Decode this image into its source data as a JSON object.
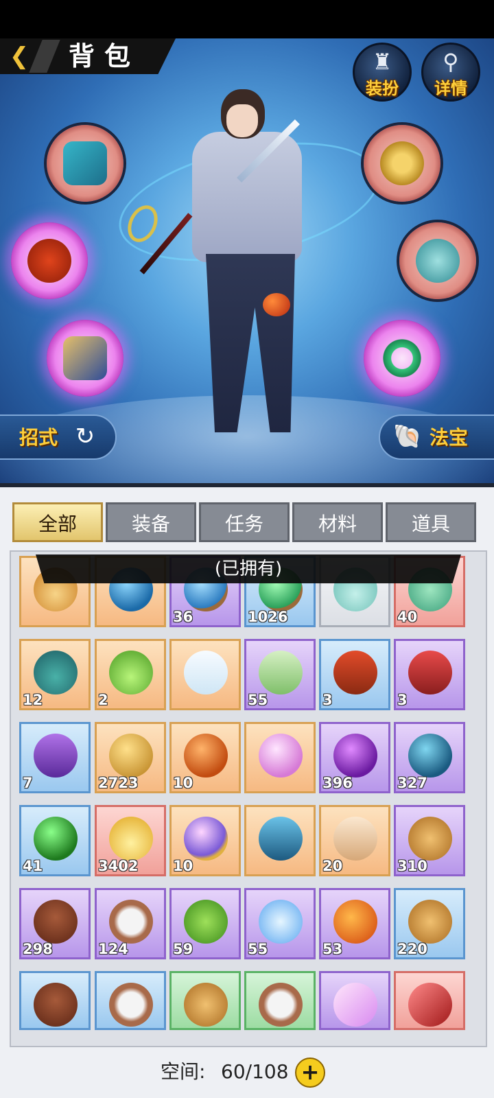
{
  "header": {
    "title": "背包",
    "back_icon": "back-arrow-icon"
  },
  "hero_buttons": {
    "outfit_label": "装扮",
    "detail_label": "详情"
  },
  "side_tabs": {
    "moves_label": "招式",
    "treasure_label": "法宝"
  },
  "tabs": [
    {
      "label": "全部",
      "active": true
    },
    {
      "label": "装备",
      "active": false
    },
    {
      "label": "任务",
      "active": false
    },
    {
      "label": "材料",
      "active": false
    },
    {
      "label": "道具",
      "active": false
    }
  ],
  "banner": "(已拥有)",
  "colors": {
    "accent_gold": "#f0c23a",
    "tab_active": "#e2c56d",
    "tab_inactive": "#868b94"
  },
  "items": [
    {
      "icon": "flame-crown-icon",
      "rarity": "orange",
      "count": ""
    },
    {
      "icon": "blue-orb-icon",
      "rarity": "orange",
      "count": ""
    },
    {
      "icon": "blue-orb-stand-icon",
      "rarity": "purple",
      "count": "36"
    },
    {
      "icon": "green-orb-stand-icon",
      "rarity": "blue",
      "count": "1026"
    },
    {
      "icon": "jade-vase-icon",
      "rarity": "gray",
      "count": ""
    },
    {
      "icon": "jade-hook-icon",
      "rarity": "red",
      "count": "40"
    },
    {
      "icon": "teal-pouch-icon",
      "rarity": "orange",
      "count": "12"
    },
    {
      "icon": "green-potion-icon",
      "rarity": "orange",
      "count": "2"
    },
    {
      "icon": "blank-scroll-icon",
      "rarity": "orange",
      "count": ""
    },
    {
      "icon": "green-talisman-icon",
      "rarity": "purple",
      "count": "55"
    },
    {
      "icon": "treasure-chest-icon",
      "rarity": "blue",
      "count": "3"
    },
    {
      "icon": "red-scroll-icon",
      "rarity": "purple",
      "count": "3"
    },
    {
      "icon": "purple-scroll-icon",
      "rarity": "blue",
      "count": "7"
    },
    {
      "icon": "golden-egg-icon",
      "rarity": "orange",
      "count": "2723"
    },
    {
      "icon": "orange-orb-icon",
      "rarity": "orange",
      "count": "10"
    },
    {
      "icon": "pink-pearl-icon",
      "rarity": "orange",
      "count": ""
    },
    {
      "icon": "purple-orb-icon",
      "rarity": "purple",
      "count": "396"
    },
    {
      "icon": "teal-orb-icon",
      "rarity": "purple",
      "count": "327"
    },
    {
      "icon": "green-orb-icon",
      "rarity": "blue",
      "count": "41"
    },
    {
      "icon": "golden-drop-icon",
      "rarity": "red",
      "count": "3402"
    },
    {
      "icon": "rainbow-orb-icon",
      "rarity": "orange",
      "count": "10"
    },
    {
      "icon": "meditation-card-icon",
      "rarity": "orange",
      "count": ""
    },
    {
      "icon": "rune-paper-icon",
      "rarity": "orange",
      "count": "20"
    },
    {
      "icon": "ginseng-icon",
      "rarity": "purple",
      "count": "310"
    },
    {
      "icon": "lingzhi-icon",
      "rarity": "purple",
      "count": "298"
    },
    {
      "icon": "rice-bowl-icon",
      "rarity": "purple",
      "count": "124"
    },
    {
      "icon": "tea-leaf-icon",
      "rarity": "purple",
      "count": "59"
    },
    {
      "icon": "blue-flower-icon",
      "rarity": "purple",
      "count": "55"
    },
    {
      "icon": "fire-fruit-icon",
      "rarity": "purple",
      "count": "53"
    },
    {
      "icon": "ginseng-icon",
      "rarity": "blue",
      "count": "220"
    },
    {
      "icon": "lingzhi-icon",
      "rarity": "blue",
      "count": ""
    },
    {
      "icon": "rice-bowl-icon",
      "rarity": "blue",
      "count": ""
    },
    {
      "icon": "ginseng-icon",
      "rarity": "green",
      "count": ""
    },
    {
      "icon": "rice-bowl-icon",
      "rarity": "green",
      "count": ""
    },
    {
      "icon": "pink-crystal-icon",
      "rarity": "purple",
      "count": ""
    },
    {
      "icon": "red-crystal-icon",
      "rarity": "red",
      "count": ""
    }
  ],
  "footer": {
    "space_label": "空间:",
    "space_value": "60/108",
    "add_icon": "plus-icon"
  }
}
